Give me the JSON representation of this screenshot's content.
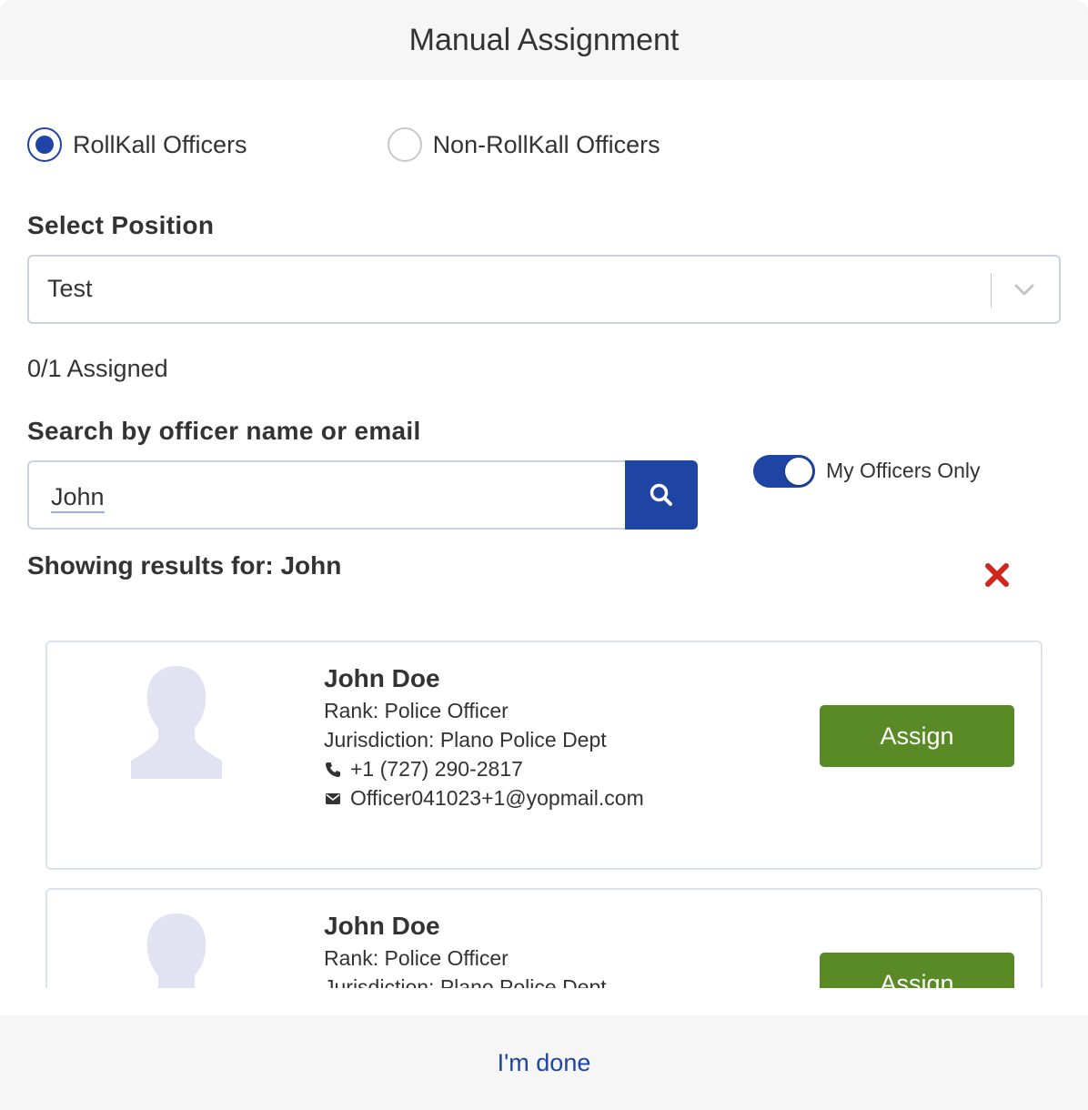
{
  "header": {
    "title": "Manual Assignment"
  },
  "officer_type": {
    "options": [
      {
        "label": "RollKall Officers",
        "selected": true
      },
      {
        "label": "Non-RollKall Officers",
        "selected": false
      }
    ]
  },
  "position": {
    "label": "Select Position",
    "selected_value": "Test"
  },
  "assigned_status": "0/1 Assigned",
  "search": {
    "label": "Search by officer name or email",
    "value": "John",
    "toggle_label": "My Officers Only",
    "toggle_on": true
  },
  "results": {
    "title": "Showing results for: John",
    "officers": [
      {
        "name": "John Doe",
        "rank": "Rank: Police Officer",
        "jurisdiction": "Jurisdiction: Plano Police Dept",
        "phone": "+1 (727) 290-2817",
        "email": "Officer041023+1@yopmail.com",
        "action_label": "Assign"
      },
      {
        "name": "John Doe",
        "rank": "Rank: Police Officer",
        "jurisdiction": "Jurisdiction: Plano Police Dept",
        "action_label": "Assign"
      }
    ]
  },
  "footer": {
    "done_label": "I'm done"
  },
  "colors": {
    "primary": "#1e45a4",
    "assign": "#5a8a26",
    "clear": "#d0261c"
  },
  "icons": [
    "chevron-down-icon",
    "search-icon",
    "close-icon",
    "avatar-silhouette-icon",
    "phone-icon",
    "envelope-icon"
  ]
}
